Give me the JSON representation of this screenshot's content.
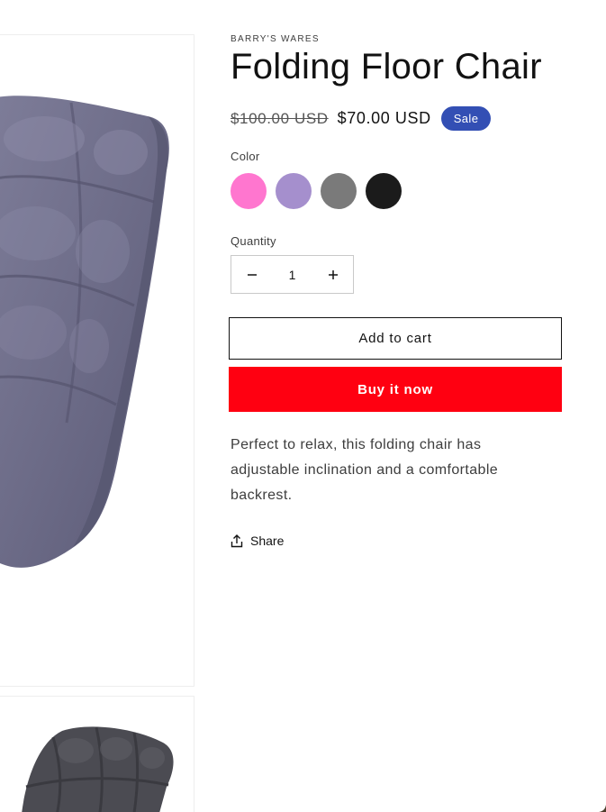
{
  "product": {
    "vendor": "BARRY'S WARES",
    "title": "Folding Floor Chair",
    "price_regular": "$100.00 USD",
    "price_sale": "$70.00 USD",
    "badge": "Sale",
    "color_label": "Color",
    "colors": [
      {
        "name": "pink",
        "hex": "#ff76cf"
      },
      {
        "name": "lavender",
        "hex": "#a58fcd"
      },
      {
        "name": "gray",
        "hex": "#7a7a7a"
      },
      {
        "name": "black",
        "hex": "#1b1b1b"
      }
    ],
    "quantity_label": "Quantity",
    "quantity_value": "1",
    "add_to_cart": "Add to cart",
    "buy_now": "Buy it now",
    "description": "Perfect to relax, this folding chair has adjustable inclination and a comfortable backrest.",
    "share": "Share"
  },
  "media": [
    {
      "name": "main-product-image",
      "icon": "floor-chair-lavender"
    },
    {
      "name": "thumbnail-image",
      "icon": "floor-chair-gray"
    }
  ],
  "theme": {
    "badge_color": "#334fb4",
    "buy_button_color": "#ff0011"
  }
}
